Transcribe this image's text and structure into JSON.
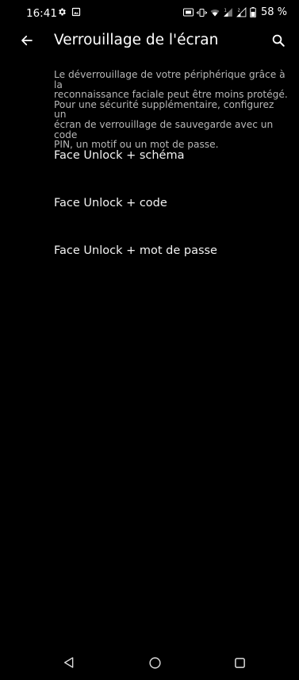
{
  "status_bar": {
    "time": "16:41",
    "battery_percent": "58 %",
    "icons_left": [
      "gear-icon",
      "image-icon"
    ],
    "icons_right": [
      "nfc-icon",
      "vibrate-icon",
      "wifi-icon",
      "signal-1-icon",
      "signal-2-icon",
      "battery-icon"
    ]
  },
  "app_bar": {
    "title": "Verrouillage de l'écran",
    "back_icon": "arrow-left-icon",
    "search_icon": "search-icon"
  },
  "description": "Le déverrouillage de votre périphérique grâce à la\nreconnaissance faciale peut être moins protégé.\nPour une sécurité supplémentaire, configurez un\nécran de verrouillage de sauvegarde avec un code\nPIN, un motif ou un mot de passe.",
  "options": [
    {
      "label": "Face Unlock + schéma"
    },
    {
      "label": "Face Unlock + code"
    },
    {
      "label": "Face Unlock + mot de passe"
    }
  ],
  "nav_bar": {
    "back_icon": "triangle-back-icon",
    "home_icon": "circle-home-icon",
    "recents_icon": "square-recents-icon"
  },
  "colors": {
    "background": "#000000",
    "text_primary": "#ffffff",
    "text_secondary": "#b7b7b7"
  }
}
